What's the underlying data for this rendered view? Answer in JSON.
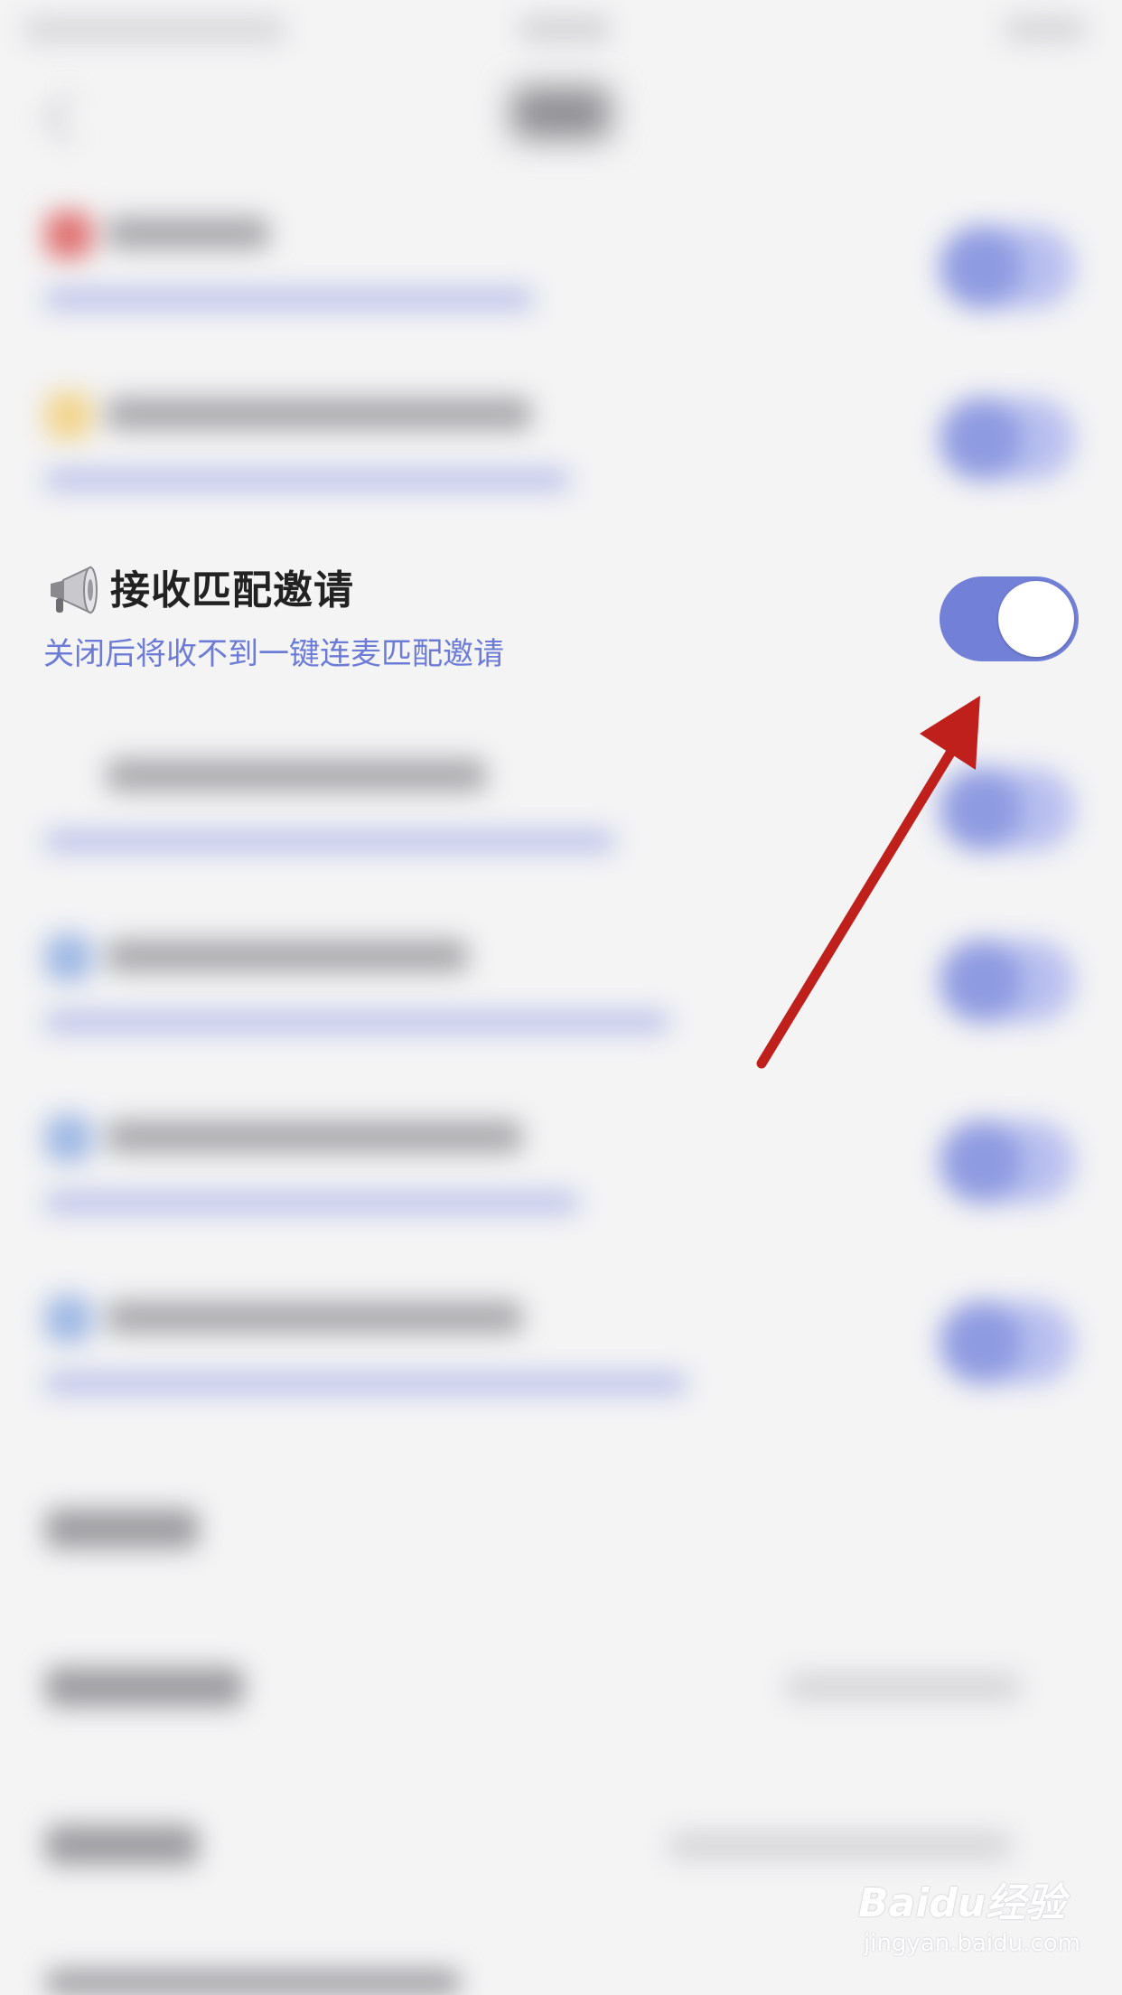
{
  "setting": {
    "title": "接收匹配邀请",
    "subtitle": "关闭后将收不到一键连麦匹配邀请",
    "toggle_on": true
  },
  "watermark": {
    "logo": "Baidu经验",
    "url": "jingyan.baidu.com"
  },
  "colors": {
    "accent": "#7280d8",
    "subtitle_text": "#6c7bd6",
    "arrow": "#c0201c",
    "background": "#f4f4f5"
  },
  "icons": {
    "setting_icon": "megaphone-icon",
    "annotation": "red-arrow"
  }
}
